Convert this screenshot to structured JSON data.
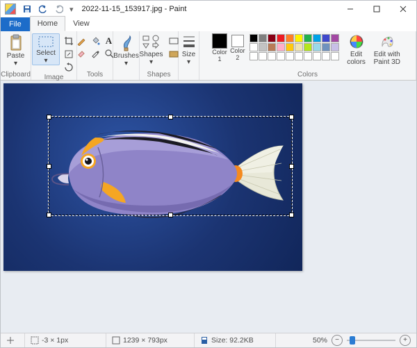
{
  "title": {
    "text": "2022-11-15_153917.jpg - Paint"
  },
  "tabs": {
    "file": "File",
    "home": "Home",
    "view": "View"
  },
  "ribbon": {
    "clipboard": {
      "label": "Clipboard",
      "paste": "Paste"
    },
    "image": {
      "label": "Image",
      "select": "Select"
    },
    "tools": {
      "label": "Tools"
    },
    "brushes": {
      "label": "Brushes"
    },
    "shapes": {
      "label": "Shapes",
      "shapes": "Shapes"
    },
    "size": {
      "label": "Size"
    },
    "colors": {
      "label": "Colors",
      "color1a": "Color",
      "color1b": "1",
      "color2a": "Color",
      "color2b": "2",
      "edit1": "Edit",
      "edit2": "colors",
      "p3d1": "Edit with",
      "p3d2": "Paint 3D",
      "color1_value": "#000000",
      "color2_value": "#ffffff",
      "palette": [
        [
          "#000000",
          "#7f7f7f",
          "#880015",
          "#ed1c24",
          "#ff7f27",
          "#fff200",
          "#22b14c",
          "#00a2e8",
          "#3f48cc",
          "#a349a4"
        ],
        [
          "#ffffff",
          "#c3c3c3",
          "#b97a57",
          "#ffaec9",
          "#ffc90e",
          "#efe4b0",
          "#b5e61d",
          "#99d9ea",
          "#7092be",
          "#c8bfe7"
        ],
        [
          "#ffffff",
          "#ffffff",
          "#ffffff",
          "#ffffff",
          "#ffffff",
          "#ffffff",
          "#ffffff",
          "#ffffff",
          "#ffffff",
          "#ffffff"
        ]
      ]
    }
  },
  "status": {
    "selection_pos": "-3 × 1px",
    "dimensions": "1239 × 793px",
    "filesize": "Size: 92.2KB",
    "zoom": "50%"
  }
}
